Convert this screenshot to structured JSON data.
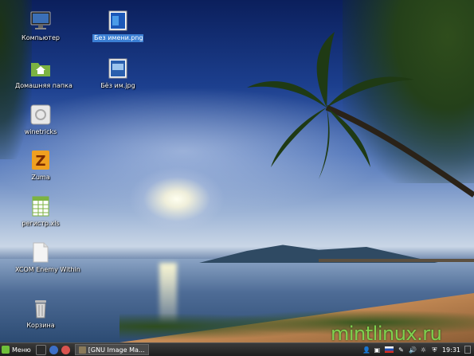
{
  "desktop": {
    "icons": [
      {
        "label": "Компьютер",
        "icon": "monitor-icon"
      },
      {
        "label": "Домашняя папка",
        "icon": "home-folder-icon"
      },
      {
        "label": "winetricks",
        "icon": "winetricks-icon"
      },
      {
        "label": "Zuma",
        "icon": "zuma-icon"
      },
      {
        "label": "регистр.xls",
        "icon": "spreadsheet-icon"
      },
      {
        "label": "XCOM Enemy Within",
        "icon": "document-icon"
      },
      {
        "label": "Корзина",
        "icon": "trash-icon"
      },
      {
        "label": "Без имени.png",
        "icon": "image-file-icon",
        "selected": true
      },
      {
        "label": "Бёз им.jpg",
        "icon": "image-file-icon"
      }
    ],
    "watermark": "mintlinux.ru"
  },
  "taskbar": {
    "menu_label": "Меню",
    "window_label": "[GNU Image Ma...",
    "clock": "19:31",
    "colors": {
      "accent": "#6fbf3a",
      "bar": "#2a2a2a"
    }
  }
}
